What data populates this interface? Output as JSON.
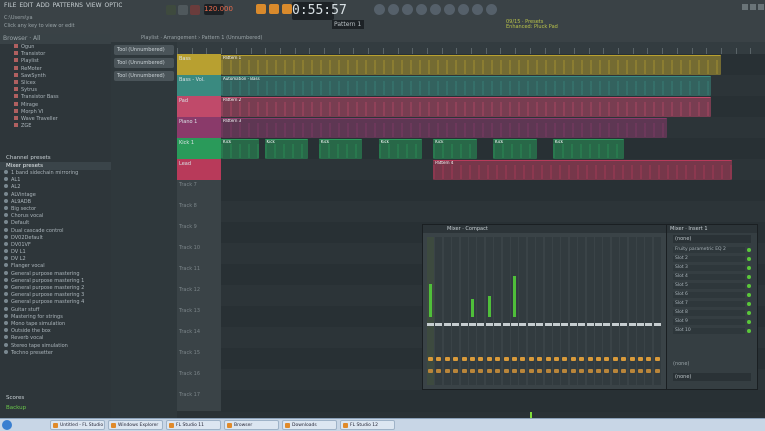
{
  "topbar": {
    "menu": [
      "FILE",
      "EDIT",
      "ADD",
      "PATTERNS",
      "VIEW",
      "OPTIONS",
      "TOOLS",
      "HELP"
    ],
    "hint_title": "C:\\Users\\ya",
    "hint_sub": "Click any key to view or edit",
    "bpm": "120.000",
    "clock": "0:55:57",
    "pattern": "Pattern 1",
    "news": "09/15 · Presets Enhanced: Pluck Pad"
  },
  "browser": {
    "header": "Browser · All",
    "tree": [
      "Ogun",
      "Transistor",
      "Playlist",
      "ReMoter",
      "SawSynth",
      "Slicex",
      "Sytrus",
      "Transistor Bass",
      "Mirage",
      "Morph VI",
      "Wave Traveller",
      "ZGE"
    ],
    "channel_presets": "Channel presets",
    "mixer_presets": "Mixer presets",
    "presets": [
      "1 band sidechain mirroring",
      "AL1",
      "AL2",
      "ALVintage",
      "AL9ADB",
      "Big sector",
      "Chorus vocal",
      "Default",
      "Dual cascade control",
      "DV02Default",
      "DV01VF",
      "DV L1",
      "DV L2",
      "Flanger vocal",
      "General purpose mastering",
      "General purpose mastering 1",
      "General purpose mastering 2",
      "General purpose mastering 3",
      "General purpose mastering 4",
      "Guitar stuff",
      "Mastering for strings",
      "Mono tape simulation",
      "Outside the box",
      "Reverb vocal",
      "Stereo tape simulation",
      "Techno presetter"
    ],
    "scores": "Scores",
    "backup": "Backup"
  },
  "playlist": {
    "toolbar": "Playlist · Arrangement › Pattern 1 (Unnumbered)",
    "patterns": [
      "Tool (Unnumbered)",
      "Tool (Unnumbered)",
      "Tool (Unnumbered)"
    ],
    "tracks": [
      {
        "label": "Bass",
        "color": "#b8a030",
        "clips": [
          {
            "start": 0.0,
            "end": 0.92,
            "title": "Pattern 1"
          }
        ]
      },
      {
        "label": "Bass - Vol.",
        "color": "#3a8a80",
        "clips": [
          {
            "start": 0.0,
            "end": 0.9,
            "title": "Automation - Bass"
          }
        ]
      },
      {
        "label": "Pad",
        "color": "#c04a6a",
        "clips": [
          {
            "start": 0.0,
            "end": 0.9,
            "title": "Pattern 2"
          }
        ]
      },
      {
        "label": "Piano 1",
        "color": "#8a3a6a",
        "clips": [
          {
            "start": 0.0,
            "end": 0.82,
            "title": "Pattern 3"
          }
        ]
      },
      {
        "label": "Kick 1",
        "color": "#2a9a5a",
        "clips": [
          {
            "start": 0.0,
            "end": 0.07,
            "title": "Kick"
          },
          {
            "start": 0.08,
            "end": 0.16,
            "title": "Kick"
          },
          {
            "start": 0.18,
            "end": 0.26,
            "title": "Kick"
          },
          {
            "start": 0.29,
            "end": 0.37,
            "title": "Kick"
          },
          {
            "start": 0.39,
            "end": 0.47,
            "title": "Kick"
          },
          {
            "start": 0.5,
            "end": 0.58,
            "title": "Kick"
          },
          {
            "start": 0.61,
            "end": 0.74,
            "title": "Kick"
          }
        ]
      },
      {
        "label": "Lead",
        "color": "#b83a5a",
        "clips": [
          {
            "start": 0.39,
            "end": 0.94,
            "title": "Pattern 4"
          }
        ]
      },
      {
        "label": "Track 7",
        "color": "",
        "clips": []
      },
      {
        "label": "Track 8",
        "color": "",
        "clips": []
      },
      {
        "label": "Track 9",
        "color": "",
        "clips": []
      },
      {
        "label": "Track 10",
        "color": "",
        "clips": []
      },
      {
        "label": "Track 11",
        "color": "",
        "clips": []
      },
      {
        "label": "Track 12",
        "color": "",
        "clips": []
      },
      {
        "label": "Track 13",
        "color": "",
        "clips": []
      },
      {
        "label": "Track 14",
        "color": "",
        "clips": []
      },
      {
        "label": "Track 15",
        "color": "",
        "clips": []
      },
      {
        "label": "Track 16",
        "color": "",
        "clips": []
      },
      {
        "label": "Track 17",
        "color": "",
        "clips": []
      }
    ]
  },
  "mixer": {
    "title": "Mixer · Compact",
    "strip_count": 28,
    "levels": [
      0.22,
      0.0,
      0.0,
      0.0,
      0.0,
      0.12,
      0.0,
      0.14,
      0.0,
      0.0,
      0.28,
      0.0,
      0.0,
      0.0,
      0.0,
      0.0,
      0.0,
      0.0,
      0.0,
      0.0,
      0.0,
      0.0,
      0.0,
      0.0,
      0.0,
      0.0,
      0.0,
      0.0
    ]
  },
  "inserts": {
    "title": "Mixer · Insert 1",
    "preset": "(none)",
    "slots": [
      "Fruity parametric EQ 2",
      "Slot 2",
      "Slot 3",
      "Slot 4",
      "Slot 5",
      "Slot 6",
      "Slot 7",
      "Slot 8",
      "Slot 9",
      "Slot 10"
    ],
    "none_label": "(none)",
    "bottom": "(none)"
  },
  "taskbar": {
    "items": [
      "",
      "",
      "",
      "",
      "",
      ""
    ],
    "tasks": [
      {
        "label": "Untitled - FL Studio"
      },
      {
        "label": "Windows Explorer"
      },
      {
        "label": "FL Studio 11"
      },
      {
        "label": "Browser"
      },
      {
        "label": "Downloads"
      },
      {
        "label": "FL Studio 12"
      }
    ]
  }
}
